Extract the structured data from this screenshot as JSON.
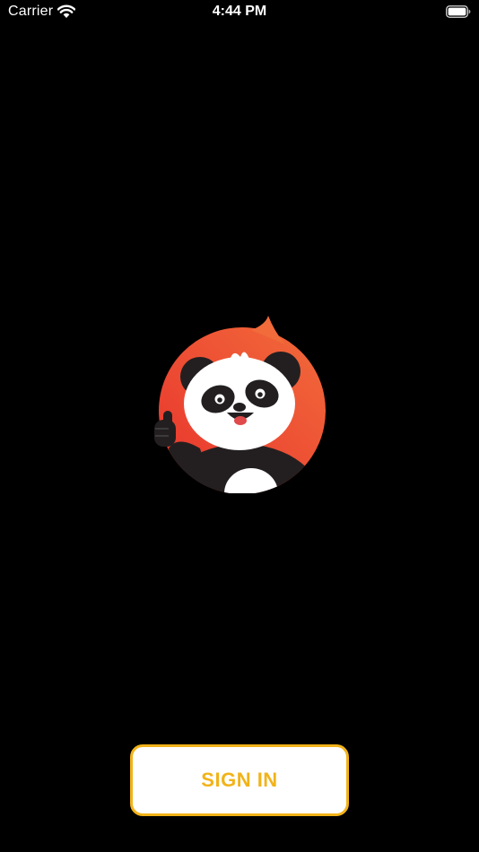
{
  "status_bar": {
    "carrier": "Carrier",
    "time": "4:44 PM",
    "icons": [
      "wifi-icon",
      "battery-icon"
    ]
  },
  "logo": {
    "icon": "panda-mascot-logo",
    "bubble_color_top": "#f26b3a",
    "bubble_color_bottom": "#e8332d"
  },
  "signin": {
    "label": "SIGN IN",
    "text_color": "#f2b319",
    "border_color": "#f2b319",
    "background": "#ffffff"
  }
}
